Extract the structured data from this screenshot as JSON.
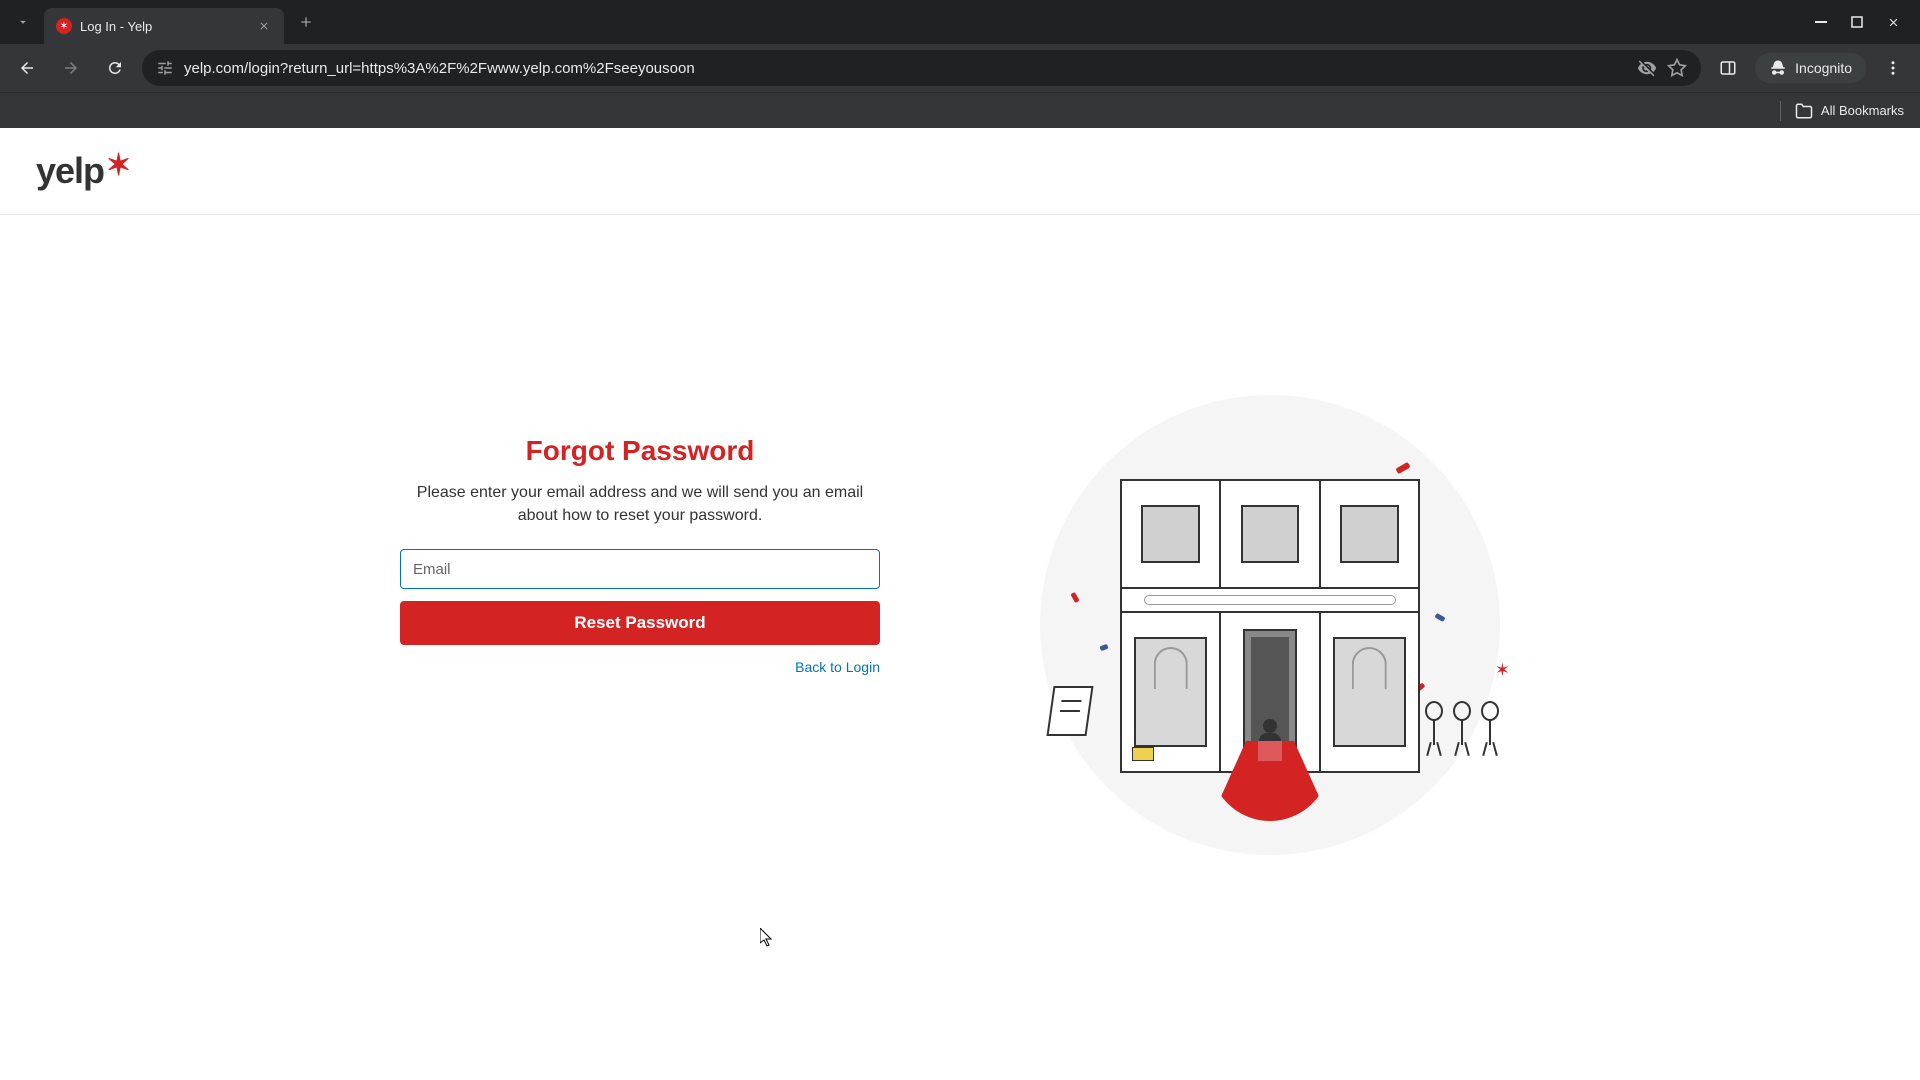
{
  "browser": {
    "tab_title": "Log In - Yelp",
    "url": "yelp.com/login?return_url=https%3A%2F%2Fwww.yelp.com%2Fseeyousoon",
    "incognito_label": "Incognito",
    "all_bookmarks": "All Bookmarks"
  },
  "logo": {
    "text": "yelp",
    "burst": "✶"
  },
  "form": {
    "title": "Forgot Password",
    "subtitle": "Please enter your email address and we will send you an email about how to reset your password.",
    "email_placeholder": "Email",
    "email_value": "",
    "reset_button": "Reset Password",
    "back_link": "Back to Login"
  }
}
